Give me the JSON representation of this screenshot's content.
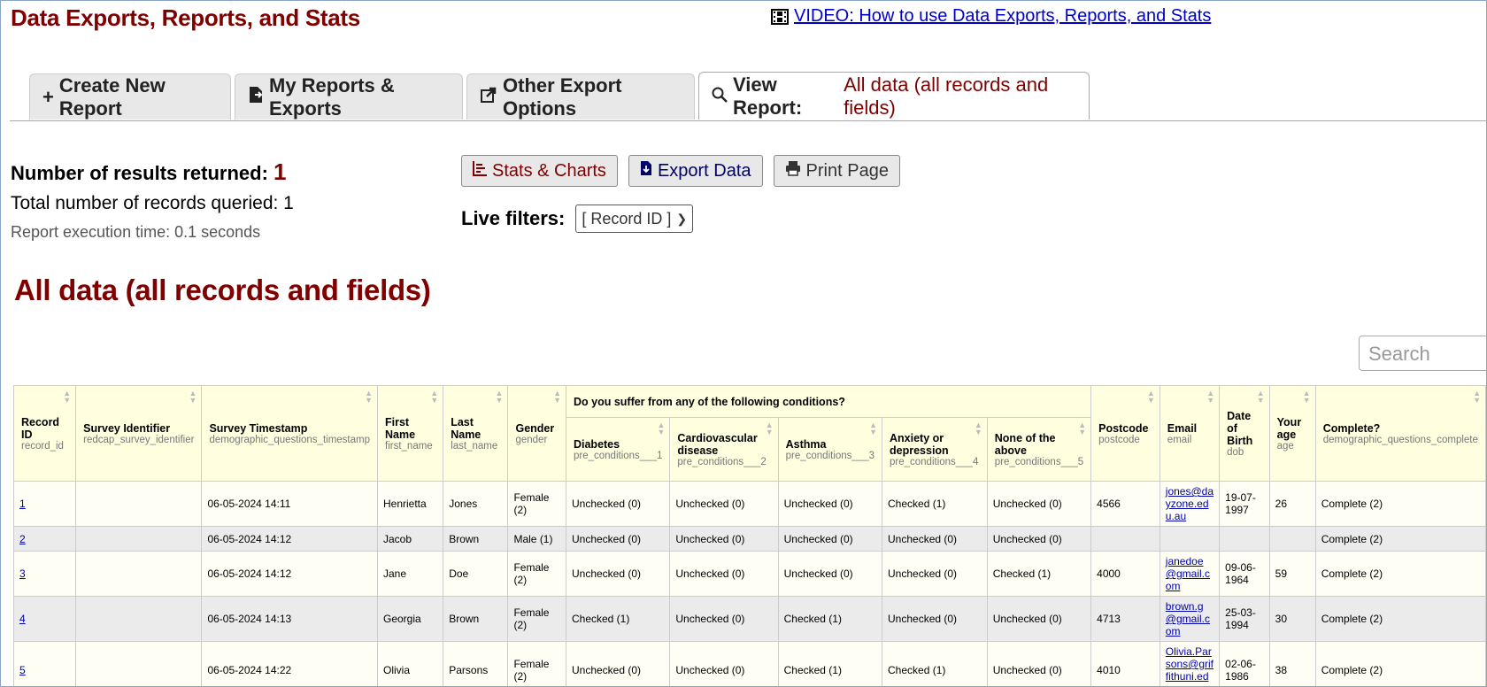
{
  "page": {
    "title": "Data Exports, Reports, and Stats",
    "video_link": "VIDEO: How to use Data Exports, Reports, and Stats"
  },
  "tabs": [
    {
      "icon": "plus-icon",
      "label": "Create New Report"
    },
    {
      "icon": "export-file-icon",
      "label": "My Reports & Exports"
    },
    {
      "icon": "share-square-icon",
      "label": "Other Export Options"
    },
    {
      "icon": "search-icon",
      "label": "View Report:",
      "sub": "All data (all records and fields)"
    }
  ],
  "summary": {
    "results_label": "Number of results returned:",
    "results_value": "1",
    "total_label": "Total number of records queried: 1",
    "time_label": "Report execution time: 0.1 seconds"
  },
  "buttons": {
    "stats": "Stats & Charts",
    "export": "Export Data",
    "print": "Print Page"
  },
  "filters": {
    "label": "Live filters:",
    "record_select": "[ Record ID ]"
  },
  "report_title": "All data (all records and fields)",
  "search": {
    "placeholder": "Search"
  },
  "table": {
    "group_header": "Do you suffer from any of the following conditions?",
    "columns": [
      {
        "label": "Record ID",
        "var": "record_id"
      },
      {
        "label": "Survey Identifier",
        "var": "redcap_survey_identifier"
      },
      {
        "label": "Survey Timestamp",
        "var": "demographic_questions_timestamp"
      },
      {
        "label": "First Name",
        "var": "first_name"
      },
      {
        "label": "Last Name",
        "var": "last_name"
      },
      {
        "label": "Gender",
        "var": "gender"
      },
      {
        "label": "Diabetes",
        "var": "pre_conditions___1"
      },
      {
        "label": "Cardiovascular disease",
        "var": "pre_conditions___2"
      },
      {
        "label": "Asthma",
        "var": "pre_conditions___3"
      },
      {
        "label": "Anxiety or depression",
        "var": "pre_conditions___4"
      },
      {
        "label": "None of the above",
        "var": "pre_conditions___5"
      },
      {
        "label": "Postcode",
        "var": "postcode"
      },
      {
        "label": "Email",
        "var": "email"
      },
      {
        "label": "Date of Birth",
        "var": "dob"
      },
      {
        "label": "Your age",
        "var": "age"
      },
      {
        "label": "Complete?",
        "var": "demographic_questions_complete"
      }
    ],
    "rows": [
      [
        "1",
        "",
        "06-05-2024 14:11",
        "Henrietta",
        "Jones",
        "Female (2)",
        "Unchecked (0)",
        "Unchecked (0)",
        "Unchecked (0)",
        "Checked (1)",
        "Unchecked (0)",
        "4566",
        "jones@dayzone.edu.au",
        "19-07-1997",
        "26",
        "Complete (2)"
      ],
      [
        "2",
        "",
        "06-05-2024 14:12",
        "Jacob",
        "Brown",
        "Male (1)",
        "Unchecked (0)",
        "Unchecked (0)",
        "Unchecked (0)",
        "Unchecked (0)",
        "Unchecked (0)",
        "",
        "",
        "",
        "",
        "Complete (2)"
      ],
      [
        "3",
        "",
        "06-05-2024 14:12",
        "Jane",
        "Doe",
        "Female (2)",
        "Unchecked (0)",
        "Unchecked (0)",
        "Unchecked (0)",
        "Unchecked (0)",
        "Checked (1)",
        "4000",
        "janedoe@gmail.com",
        "09-06-1964",
        "59",
        "Complete (2)"
      ],
      [
        "4",
        "",
        "06-05-2024 14:13",
        "Georgia",
        "Brown",
        "Female (2)",
        "Checked (1)",
        "Unchecked (0)",
        "Checked (1)",
        "Unchecked (0)",
        "Unchecked (0)",
        "4713",
        "brown.g@gmail.com",
        "25-03-1994",
        "30",
        "Complete (2)"
      ],
      [
        "5",
        "",
        "06-05-2024 14:22",
        "Olivia",
        "Parsons",
        "Female (2)",
        "Unchecked (0)",
        "Unchecked (0)",
        "Checked (1)",
        "Checked (1)",
        "Unchecked (0)",
        "4010",
        "Olivia.Parsons@griffithuni.edu.au",
        "02-06-1986",
        "38",
        "Complete (2)"
      ]
    ]
  }
}
